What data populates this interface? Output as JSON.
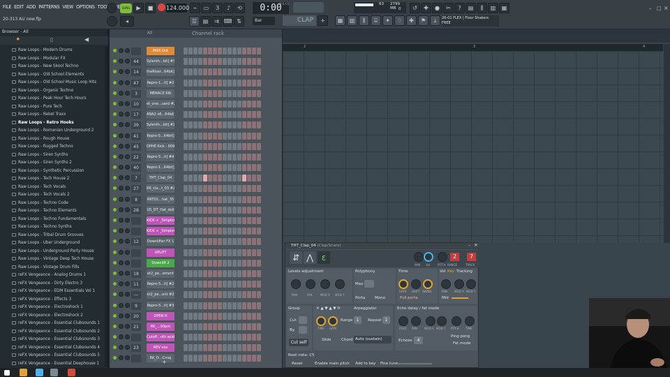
{
  "menu": [
    "FILE",
    "EDIT",
    "ADD",
    "PATTERNS",
    "VIEW",
    "OPTIONS",
    "TOOLS",
    "HELP"
  ],
  "filename": "20-313 AU new.flp",
  "transport": {
    "song_mode": "SONG",
    "tempo": "124.000",
    "time": "0:00",
    "time_unit": "M:S:CS",
    "snap": "Bar",
    "pattern": "CLAP"
  },
  "cpu": {
    "mem": "2799 MB",
    "cpu_value": "63",
    "voices": "0"
  },
  "hint": {
    "line1": "26-01  FLEX | Floor Shakers",
    "line2": "FREE"
  },
  "browser": {
    "title": "Browser - All",
    "items": [
      "Raw Loops - Modern Drums",
      "Raw Loops - Modular FX",
      "Raw Loops - New Skool Techno",
      "Raw Loops - Old School Elements",
      "Raw Loops - Old School Music Loop Hits",
      "Raw Loops - Organic Techno",
      "Raw Loops - Peak Hour Tech Hours",
      "Raw Loops - Pure Tech",
      "Raw Loops - Rebel Traxx",
      "Raw Loops - Retro Hooks",
      "Raw Loops - Romanian Underground 2",
      "Raw Loops - Rough House",
      "Raw Loops - Rugged Techno",
      "Raw Loops - Siren Synths",
      "Raw Loops - Siren Synths 2",
      "Raw Loops - Synthetic Percussion",
      "Raw Loops - Tech House 2",
      "Raw Loops - Tech Vocals",
      "Raw Loops - Tech Vocals 2",
      "Raw Loops - Techno Code",
      "Raw Loops - Techno Elements",
      "Raw Loops - Techno Fundamentals",
      "Raw Loops - Techno Synths",
      "Raw Loops - Tribal Drum Grooves",
      "Raw Loops - Uber Underground",
      "Raw Loops - Underground Party House",
      "Raw Loops - Vintage Deep Tech House",
      "Raw Loops - Vintage Drum Fills",
      "reFX Vengeance - Analog Drums 1",
      "reFX Vengeance - Dirty Electro 3",
      "reFX Vengeance - EDM Essentials Vol 1",
      "reFX Vengeance - Effects 3",
      "reFX Vengeance - Electroshock 1",
      "reFX Vengeance - Electroshock 2",
      "reFX Vengeance - Essential Clubsounds 1",
      "reFX Vengeance - Essential Clubsounds 2",
      "reFX Vengeance - Essential Clubsounds 3",
      "reFX Vengeance - Essential Clubsounds 4",
      "reFX Vengeance - Essential Clubsounds 5",
      "reFX Vengeance - Essential Deephouse 1"
    ],
    "selected_index": 9
  },
  "rack": {
    "title": "Channel rack",
    "filter": "All",
    "channels": [
      {
        "num": "",
        "name": "MIDI Out",
        "color": "orange"
      },
      {
        "num": "44",
        "name": "Sylenth...bit] #3",
        "color": ""
      },
      {
        "num": "14",
        "name": "theRiser...64bit]",
        "color": ""
      },
      {
        "num": "47",
        "name": "Repro-1...it] #2",
        "color": ""
      },
      {
        "num": "3",
        "name": "MENACE KIK",
        "color": ""
      },
      {
        "num": "10",
        "name": "et_one...uard #2",
        "color": ""
      },
      {
        "num": "17",
        "name": "ANA2 x6...64bit]",
        "color": ""
      },
      {
        "num": "39",
        "name": "Sylenth...bit] #2",
        "color": ""
      },
      {
        "num": "41",
        "name": "Repro-5...64bit]",
        "color": ""
      },
      {
        "num": "45",
        "name": "DPHE Kick - 009",
        "color": ""
      },
      {
        "num": "22",
        "name": "Repro-5...it] #4",
        "color": ""
      },
      {
        "num": "40",
        "name": "Repro-1...64bit]",
        "color": ""
      },
      {
        "num": "7",
        "name": "THT_Clap_04",
        "color": ""
      },
      {
        "num": "27",
        "name": "RK_cla...t_03 #2",
        "color": ""
      },
      {
        "num": "8",
        "name": "RKTD1...hat_35",
        "color": ""
      },
      {
        "num": "28",
        "name": "US_DT_Hat_doll",
        "color": ""
      },
      {
        "num": "",
        "name": "KICK + _Simplon",
        "color": "pink"
      },
      {
        "num": "",
        "name": "KICK + _Simplon",
        "color": "pink"
      },
      {
        "num": "12",
        "name": "Downlifter FX 1",
        "color": ""
      },
      {
        "num": "",
        "name": "UPLIFT",
        "color": "pink"
      },
      {
        "num": "",
        "name": "Downlift 2",
        "color": "green"
      },
      {
        "num": "18",
        "name": "et2_pe...ement",
        "color": ""
      },
      {
        "num": "11",
        "name": "Repro-5...it] #2",
        "color": ""
      },
      {
        "num": "---",
        "name": "et2_pe...ent #2",
        "color": ""
      },
      {
        "num": "9",
        "name": "Repro-5...it] #3",
        "color": ""
      },
      {
        "num": "20",
        "name": "OPEN H",
        "color": "pink"
      },
      {
        "num": "21",
        "name": "RK_...50pm",
        "color": "pink"
      },
      {
        "num": "",
        "name": "Cutoff...nth acid",
        "color": "pink"
      },
      {
        "num": "23",
        "name": "REV vox",
        "color": "pink"
      },
      {
        "num": "",
        "name": "RK_D...Cmaj",
        "color": ""
      }
    ]
  },
  "playlist": {
    "bars": [
      "2",
      "3",
      "4"
    ]
  },
  "channel_settings": {
    "title": "THT_Clap_04",
    "title_suffix": "(Clap/Snare)",
    "pan": "PAN",
    "vol": "Vol",
    "pitch": "PITCH",
    "pitch_value": "2",
    "track": "TRACK",
    "track_value": "7",
    "range": "RANGE",
    "levels": "Levels adjustment",
    "levels_knobs": [
      "PAN",
      "VOL",
      "MOD X",
      "MOD Y"
    ],
    "polyphony": "Polyphony",
    "max": "Max",
    "porta": "Porta",
    "mono": "Mono",
    "time": "Time",
    "time_knobs": [
      "GATE",
      "SHIFT",
      "SWING"
    ],
    "full_porta": "Full porta",
    "key": "Key",
    "tracking": "Tracking",
    "tracking_knobs": [
      "PAN",
      "MOD X",
      "MOD Y"
    ],
    "mid": "Mid",
    "group": "Group",
    "arpeggiator": "Arpeggiator",
    "cut": "Cut",
    "by": "By",
    "cut_self": "Cut self",
    "arp_knobs": [
      "TIME",
      "GATE"
    ],
    "arp_range": "Range",
    "arp_range_value": "1",
    "arp_repeat": "Repeat",
    "arp_repeat_value": "1",
    "slide": "Slide",
    "chord": "Chord",
    "chord_value": "Auto (sustain)",
    "echo": "Echo delay / fat mode",
    "echo_knobs": [
      "FEED",
      "PAN",
      "MOD X",
      "MOD Y",
      "PITCH",
      "TIME"
    ],
    "echoes": "Echoes",
    "echoes_value": "4",
    "ping_pong": "Ping pong",
    "fat_mode": "Fat mode",
    "root_note": "Root note: C5",
    "reset": "Reset",
    "enable_main_pitch": "Enable main pitch",
    "add_to_key": "Add to key",
    "fine_tune": "Fine tune"
  }
}
